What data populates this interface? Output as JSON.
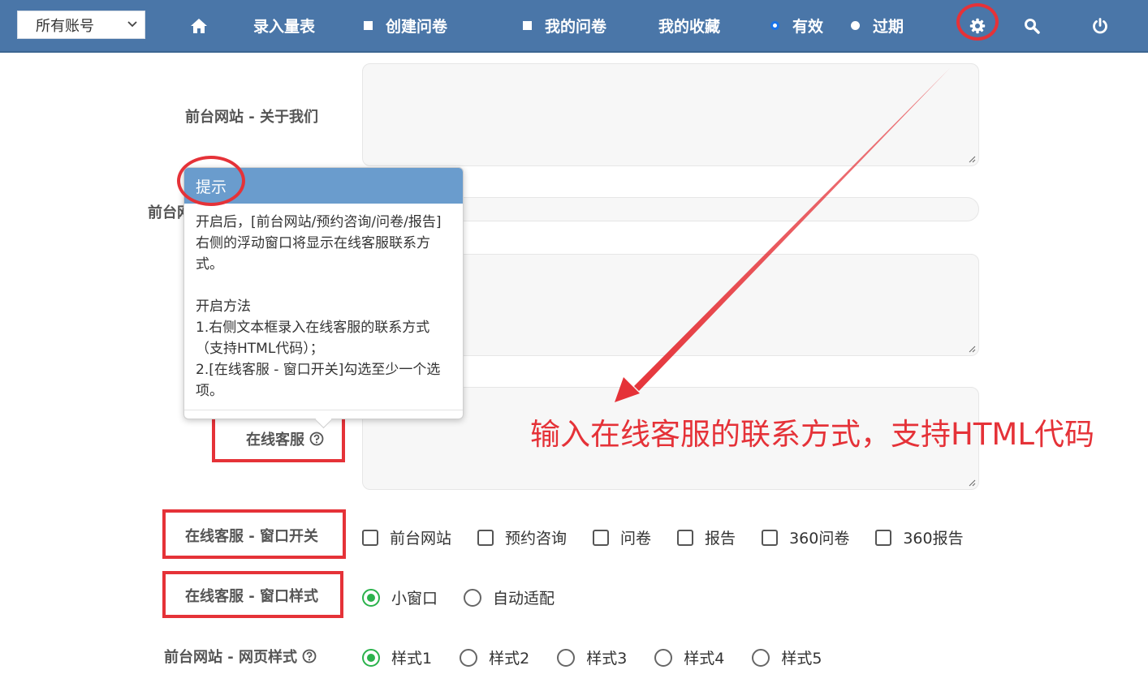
{
  "navbar": {
    "account_select": "所有账号",
    "items": [
      {
        "label": "录入量表"
      },
      {
        "label": "创建问卷"
      },
      {
        "label": "我的问卷"
      },
      {
        "label": "我的收藏"
      },
      {
        "label": "有效"
      },
      {
        "label": "过期"
      }
    ],
    "status_filter_selected": "有效",
    "icons": [
      "home-icon",
      "gear-icon",
      "search-icon",
      "power-icon"
    ]
  },
  "form": {
    "about_us_label": "前台网站 - 关于我们",
    "partial_label": "前台网",
    "online_service_label": "在线客服",
    "window_switch": {
      "label": "在线客服 - 窗口开关",
      "options": [
        "前台网站",
        "预约咨询",
        "问卷",
        "报告",
        "360问卷",
        "360报告"
      ],
      "checked": []
    },
    "window_style": {
      "label": "在线客服 - 窗口样式",
      "options": [
        "小窗口",
        "自动适配"
      ],
      "selected": "小窗口"
    },
    "page_style": {
      "label": "前台网站 - 网页样式",
      "options": [
        "样式1",
        "样式2",
        "样式3",
        "样式4",
        "样式5"
      ],
      "selected": "样式1"
    }
  },
  "tooltip": {
    "title": "提示",
    "body": "开启后，[前台网站/预约咨询/问卷/报告]右侧的浮动窗口将显示在线客服联系方式。\n\n开启方法\n1.右侧文本框录入在线客服的联系方式（支持HTML代码）；\n2.[在线客服 - 窗口开关]勾选至少一个选项。"
  },
  "annotation": {
    "text": "输入在线客服的联系方式，支持HTML代码",
    "color": "#e53238"
  },
  "colors": {
    "navbar": "#4a76a8",
    "tooltip_header": "#6a9ccd",
    "radio_selected": "#2bb24c",
    "annotation_red": "#e53238"
  }
}
